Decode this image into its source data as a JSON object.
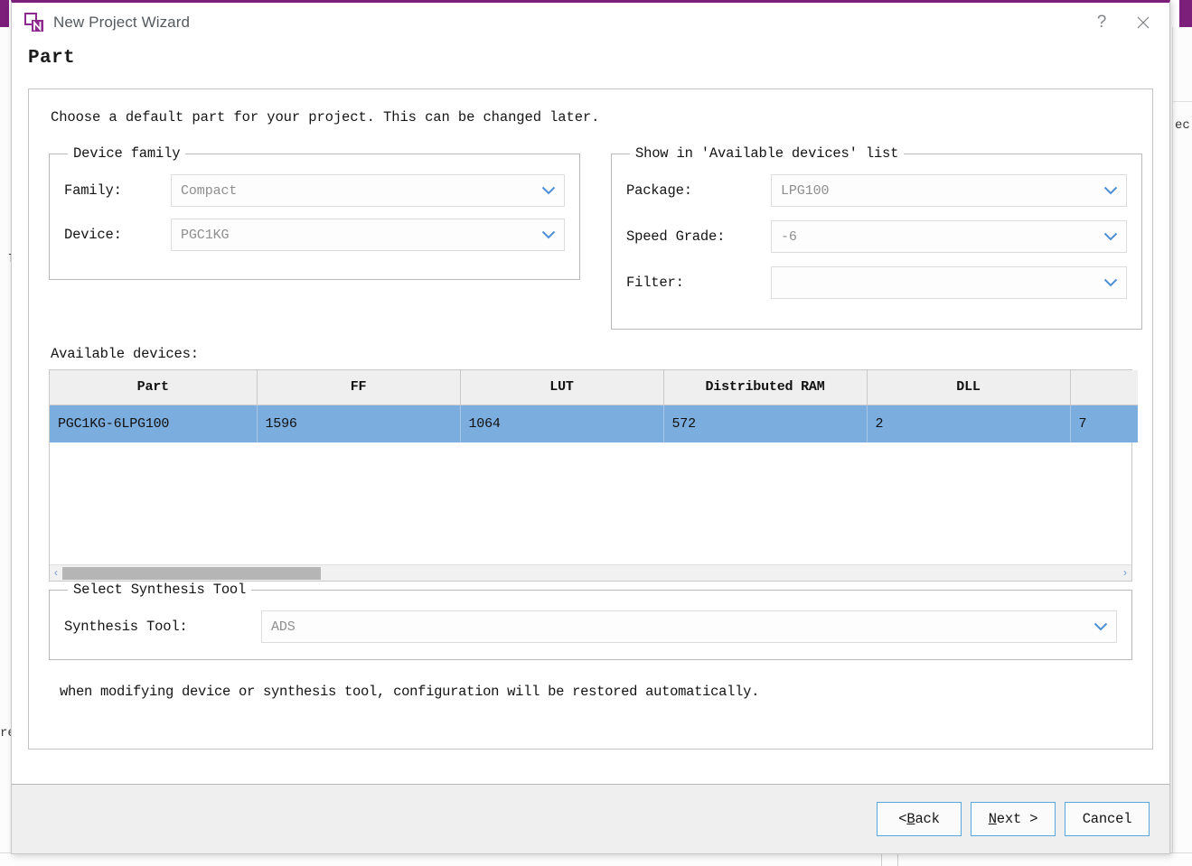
{
  "window": {
    "title": "New Project Wizard",
    "logo_icon": "nproject-logo-icon",
    "help_label": "?",
    "close_label": "✕",
    "accent_color": "#7b1f7b"
  },
  "page": {
    "title": "Part",
    "intro": "Choose a default part for your project. This can be changed later.",
    "note": "when modifying device or synthesis tool, configuration will be restored automatically."
  },
  "device_family": {
    "legend": "Device family",
    "family": {
      "label": "Family:",
      "value": "Compact"
    },
    "device": {
      "label": "Device:",
      "value": "PGC1KG"
    }
  },
  "show_in_list": {
    "legend": "Show in 'Available devices' list",
    "package": {
      "label": "Package:",
      "value": "LPG100"
    },
    "speed_grade": {
      "label": "Speed Grade:",
      "value": "-6"
    },
    "filter": {
      "label": "Filter:",
      "value": ""
    }
  },
  "available_devices": {
    "label": "Available devices:",
    "columns": [
      "Part",
      "FF",
      "LUT",
      "Distributed RAM",
      "DLL",
      ""
    ],
    "rows": [
      {
        "part": "PGC1KG-6LPG100",
        "ff": "1596",
        "lut": "1064",
        "distributed_ram": "572",
        "dll": "2",
        "extra": "7",
        "selected": true
      }
    ],
    "selection_color": "#7badde",
    "scroll_left_arrow": "‹",
    "scroll_right_arrow": "›"
  },
  "synthesis": {
    "legend": "Select Synthesis Tool",
    "tool": {
      "label": "Synthesis Tool:",
      "value": "ADS"
    }
  },
  "footer": {
    "back": {
      "pre": "< ",
      "mnemonic": "B",
      "post": "ack"
    },
    "next": {
      "pre": "",
      "mnemonic": "N",
      "post": "ext >"
    },
    "cancel": {
      "label": "Cancel"
    }
  },
  "background": {
    "left_fragment": "re",
    "left_fragment2": "l",
    "right_fragment": "ec"
  }
}
